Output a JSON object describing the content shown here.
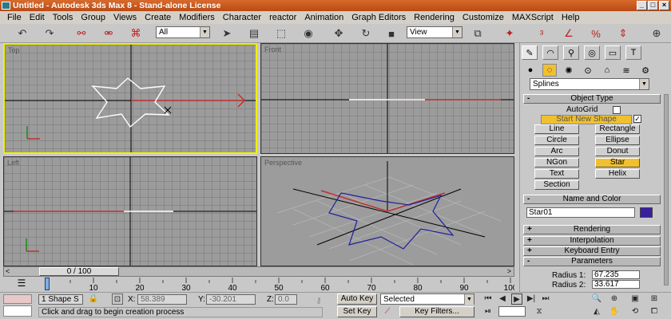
{
  "window": {
    "title": "Untitled - Autodesk 3ds Max 8 - Stand-alone License",
    "controls": [
      "_",
      "□",
      "×"
    ]
  },
  "menu": [
    "File",
    "Edit",
    "Tools",
    "Group",
    "Views",
    "Create",
    "Modifiers",
    "Character",
    "reactor",
    "Animation",
    "Graph Editors",
    "Rendering",
    "Customize",
    "MAXScript",
    "Help"
  ],
  "toolbar": {
    "selection_filter": "All",
    "reference_coord": "View",
    "icons": [
      "undo-icon",
      "redo-icon",
      "link-icon",
      "unlink-icon",
      "bind-space-warp-icon",
      "select-icon",
      "select-by-name-icon",
      "rect-region-icon",
      "window-crossing-icon",
      "select-move-icon",
      "select-rotate-icon",
      "select-scale-icon",
      "pivot-icon",
      "manipulate-icon",
      "snap-3d-icon",
      "angle-snap-icon",
      "percent-snap-icon",
      "spinner-snap-icon"
    ]
  },
  "viewports": [
    {
      "id": "top",
      "label": "Top",
      "active": true
    },
    {
      "id": "front",
      "label": "Front",
      "active": false
    },
    {
      "id": "left",
      "label": "Left",
      "active": false
    },
    {
      "id": "perspective",
      "label": "Perspective",
      "active": false
    }
  ],
  "command_panel": {
    "category_dropdown": "Splines",
    "object_type": {
      "header": "Object Type",
      "autogrid_label": "AutoGrid",
      "autogrid_checked": false,
      "start_new_shape_label": "Start New Shape",
      "start_new_shape_checked": true,
      "buttons": [
        "Line",
        "Rectangle",
        "Circle",
        "Ellipse",
        "Arc",
        "Donut",
        "NGon",
        "Star",
        "Text",
        "Helix",
        "Section"
      ],
      "active_button": "Star"
    },
    "name_and_color": {
      "header": "Name and Color",
      "name_value": "Star01",
      "color": "#3a20a0"
    },
    "rollouts_collapsed": [
      "Rendering",
      "Interpolation",
      "Keyboard Entry"
    ],
    "parameters": {
      "header": "Parameters",
      "radius1_label": "Radius 1:",
      "radius1_value": "67.235",
      "radius2_label": "Radius 2:",
      "radius2_value": "33.617"
    }
  },
  "time": {
    "slider_label": "0 / 100",
    "ticks": [
      "0",
      "10",
      "20",
      "30",
      "40",
      "50",
      "60",
      "70",
      "80",
      "90",
      "100"
    ],
    "current_frame": 0,
    "total_frames": 100
  },
  "status": {
    "selection_count": "1 Shape S",
    "x_label": "X:",
    "x_value": "58.389",
    "y_label": "Y:",
    "y_value": "-30.201",
    "z_label": "Z:",
    "z_value": "0.0",
    "prompt": "Click and drag to begin creation process",
    "auto_key": "Auto Key",
    "set_key": "Set Key",
    "selected": "Selected",
    "key_filters": "Key Filters..."
  },
  "colors": {
    "title_bar": "#c85a20",
    "active_viewport_border": "#f0f000",
    "active_button": "#f0c030"
  }
}
